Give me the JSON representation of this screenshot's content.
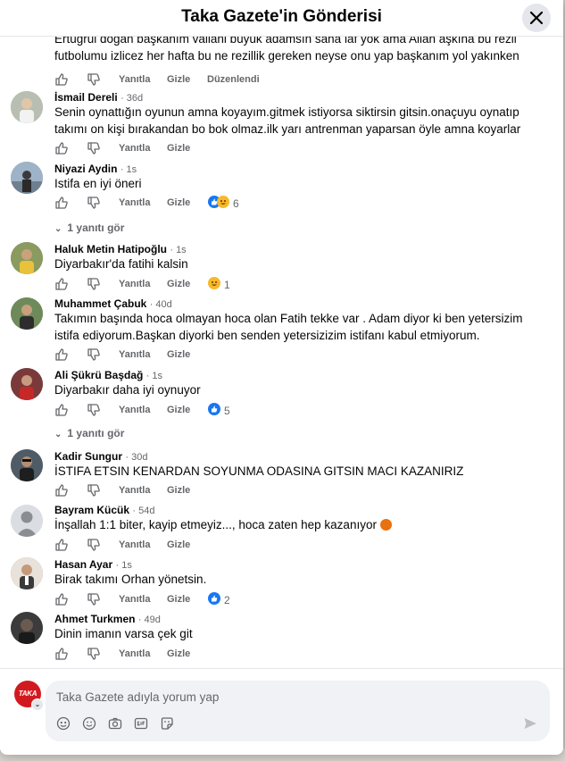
{
  "header": {
    "title": "Taka Gazete'in Gönderisi"
  },
  "actions": {
    "like": "Yanıtla",
    "hide": "Gizle",
    "edited": "Düzenlendi"
  },
  "comments": [
    {
      "name": "",
      "time": "",
      "text": "Ertuğrul doğan başkanım vallahi büyük adamsın sana laf yok ama Allah aşkına bu rezil futbolumu izlicez her hafta bu ne rezillik gereken neyse onu yap başkanım yol yakınken"
    },
    {
      "name": "İsmail Dereli",
      "time": "· 36d",
      "text": "Senin oynattığın oyunun amna koyayım.gitmek istiyorsa siktirsin gitsin.onaçuyu oynatıp takımı on kişi bırakandan bo bok olmaz.ilk yarı antrenman yaparsan öyle amna koyarlar"
    },
    {
      "name": "Niyazi Aydin",
      "time": "· 1s",
      "text": "Istifa en iyi öneri",
      "reactions": "6"
    },
    {
      "name": "Haluk Metin Hatipoğlu",
      "time": "· 1s",
      "text": "Diyarbakır'da fatihi kalsin",
      "reactions": "1"
    },
    {
      "name": "Muhammet Çabuk",
      "time": "· 40d",
      "text": "Takımın başında hoca olmayan hoca olan Fatih tekke var . Adam diyor ki ben yetersizim istifa ediyorum.Başkan diyorki ben senden yetersizizim istifanı kabul etmiyorum."
    },
    {
      "name": "Ali Şükrü Başdağ",
      "time": "· 1s",
      "text": "Diyarbakır daha iyi oynuyor",
      "reactions": "5"
    },
    {
      "name": "Kadir Sungur",
      "time": "· 30d",
      "text": "İSTIFA ETSIN KENARDAN SOYUNMA ODASINA GITSIN MACI KAZANIRIZ"
    },
    {
      "name": "Bayram Kücük",
      "time": "· 54d",
      "text": "İnşallah 1:1 biter, kayip etmeyiz..., hoca zaten hep kazanıyor"
    },
    {
      "name": "Hasan Ayar",
      "time": "· 1s",
      "text": "Birak takımı Orhan yönetsin.",
      "reactions": "2"
    },
    {
      "name": "Ahmet Turkmen",
      "time": "· 49d",
      "text": "Dinin imanın varsa çek git"
    }
  ],
  "replies": {
    "niyazi": "1 yanıtı gör",
    "ali": "1 yanıtı gör"
  },
  "input": {
    "placeholder": "Taka Gazete adıyla yorum yap",
    "avatar_text": "TAKA"
  }
}
